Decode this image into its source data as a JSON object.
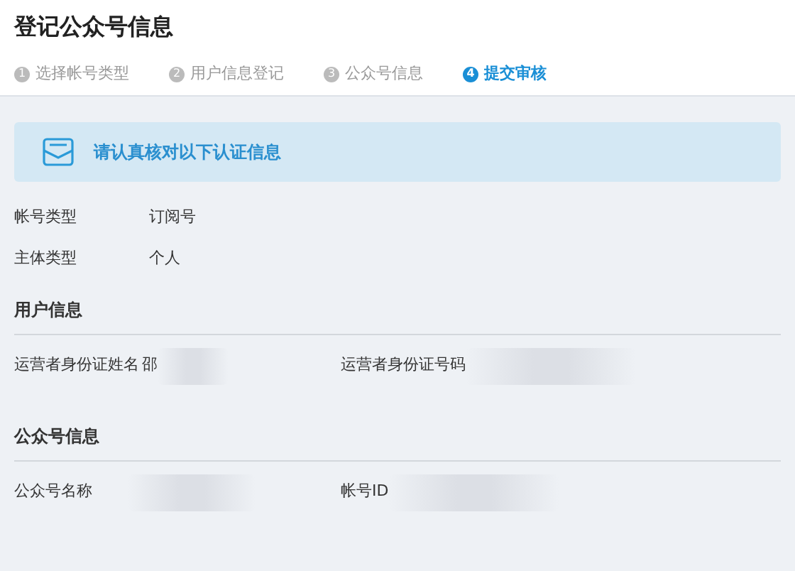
{
  "page_title": "登记公众号信息",
  "steps": [
    {
      "number": "1",
      "label": "选择帐号类型",
      "selected": false
    },
    {
      "number": "2",
      "label": "用户信息登记",
      "selected": false
    },
    {
      "number": "3",
      "label": "公众号信息",
      "selected": false
    },
    {
      "number": "4",
      "label": "提交审核",
      "selected": true
    }
  ],
  "notice": "请认真核对以下认证信息",
  "basic_fields": [
    {
      "label": "帐号类型",
      "value": "订阅号"
    },
    {
      "label": "主体类型",
      "value": "个人"
    }
  ],
  "sections": [
    {
      "title": "用户信息",
      "fields": [
        {
          "label": "运营者身份证姓名",
          "value": "邵"
        },
        {
          "label": "运营者身份证号码"
        }
      ]
    },
    {
      "title": "公众号信息",
      "fields": [
        {
          "label": "公众号名称"
        },
        {
          "label": "帐号ID"
        }
      ]
    }
  ]
}
